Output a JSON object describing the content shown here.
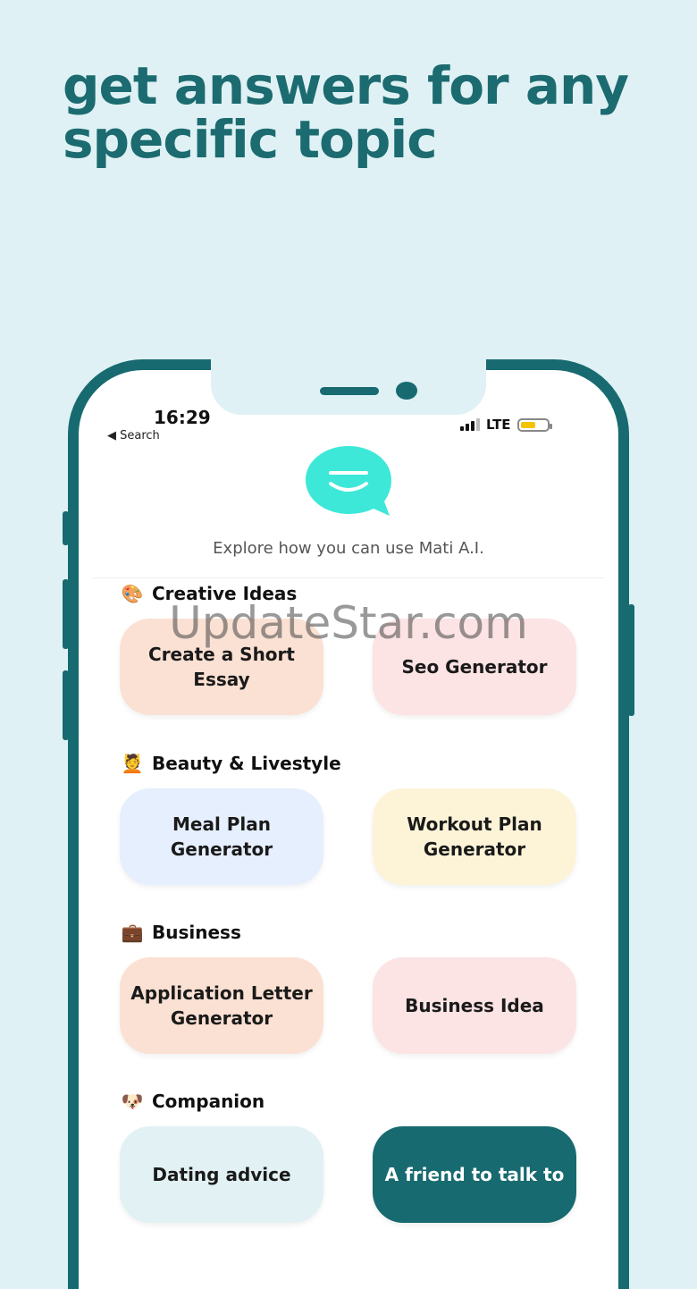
{
  "headline": {
    "line1": "get answers for any",
    "line2": "specific topic"
  },
  "status_bar": {
    "time": "16:29",
    "back_label": "◀ Search",
    "network": "LTE"
  },
  "app": {
    "logo_icon": "chat-bubble-smile-icon",
    "subtitle": "Explore how you can use Mati A.I."
  },
  "sections": [
    {
      "title": "Creative Ideas",
      "emoji": "🎨",
      "cards": [
        {
          "label": "Create a Short Essay",
          "color": "#fbe1d3"
        },
        {
          "label": "Seo Generator",
          "color": "#fce3e4"
        }
      ]
    },
    {
      "title": "Beauty & Livestyle",
      "emoji": "💆",
      "cards": [
        {
          "label": "Meal Plan Generator",
          "color": "#e5effd"
        },
        {
          "label": "Workout Plan Generator",
          "color": "#fdf4d8"
        }
      ]
    },
    {
      "title": "Business",
      "emoji": "💼",
      "cards": [
        {
          "label": "Application Letter Generator",
          "color": "#fbe1d3"
        },
        {
          "label": "Business Idea",
          "color": "#fce3e4"
        }
      ]
    },
    {
      "title": "Companion",
      "emoji": "🐶",
      "cards": [
        {
          "label": "Dating advice",
          "color": "#e2f1f3"
        },
        {
          "label": "A friend to talk to",
          "color": "#176a70"
        }
      ]
    }
  ],
  "watermark": "UpdateStar.com",
  "colors": {
    "accent": "#176a70",
    "background": "#dff1f4",
    "logo": "#3de8d8"
  }
}
